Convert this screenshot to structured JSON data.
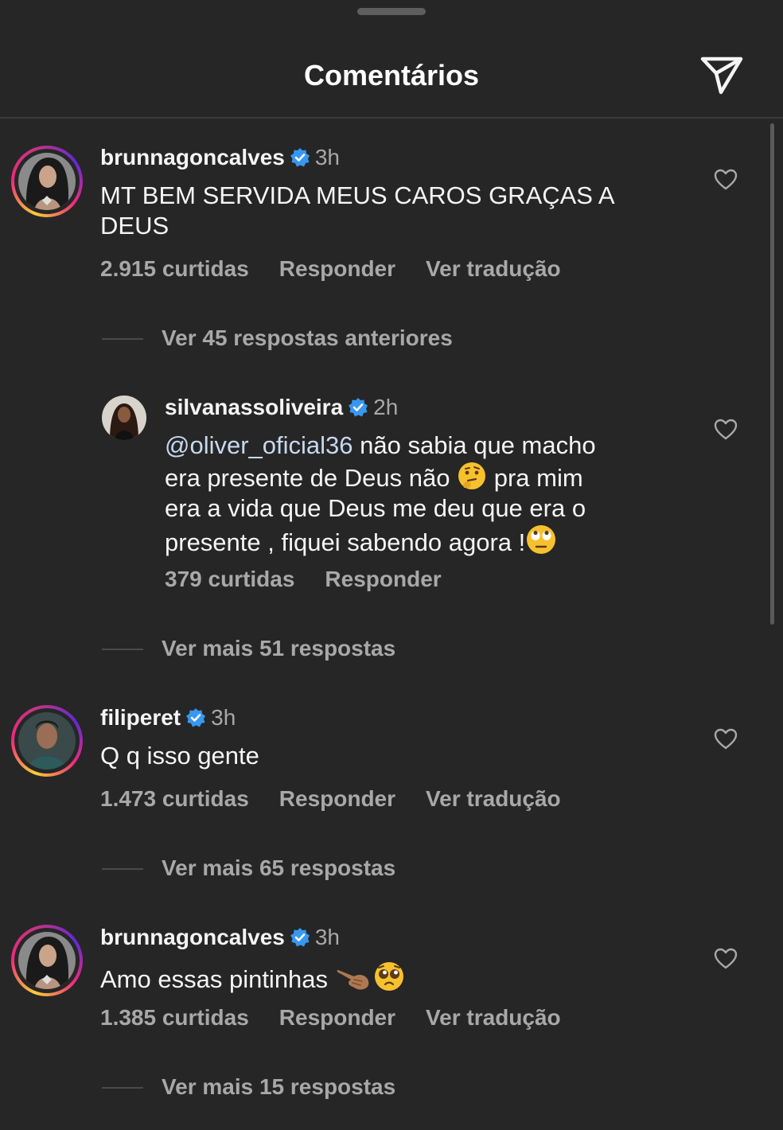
{
  "header": {
    "title": "Comentários"
  },
  "comments": [
    {
      "username": "brunnagoncalves",
      "time": "3h",
      "text": "MT BEM SERVIDA MEUS CAROS GRAÇAS A DEUS",
      "likes": "2.915 curtidas",
      "reply": "Responder",
      "translate": "Ver tradução",
      "view_replies": "Ver 45 respostas anteriores"
    },
    {
      "username": "silvanassoliveira",
      "time": "2h",
      "mention": "@oliver_oficial36",
      "text_a": " não sabia que macho",
      "text_b": "era presente de Deus não",
      "text_c": "  pra mim",
      "text_d": "era a vida que Deus me deu que era o",
      "text_e": "presente , fiquei sabendo agora !",
      "likes": "379 curtidas",
      "reply": "Responder",
      "view_replies": "Ver mais 51 respostas"
    },
    {
      "username": "filiperet",
      "time": "3h",
      "text": "Q q isso gente",
      "likes": "1.473 curtidas",
      "reply": "Responder",
      "translate": "Ver tradução",
      "view_replies": "Ver mais 65 respostas"
    },
    {
      "username": "brunnagoncalves",
      "time": "3h",
      "text": "Amo essas pintinhas ",
      "likes": "1.385 curtidas",
      "reply": "Responder",
      "translate": "Ver tradução",
      "view_replies": "Ver mais 15 respostas"
    }
  ],
  "colors": {
    "background": "#262626",
    "verified": "#3897f0",
    "muted": "#a8a8a8"
  }
}
